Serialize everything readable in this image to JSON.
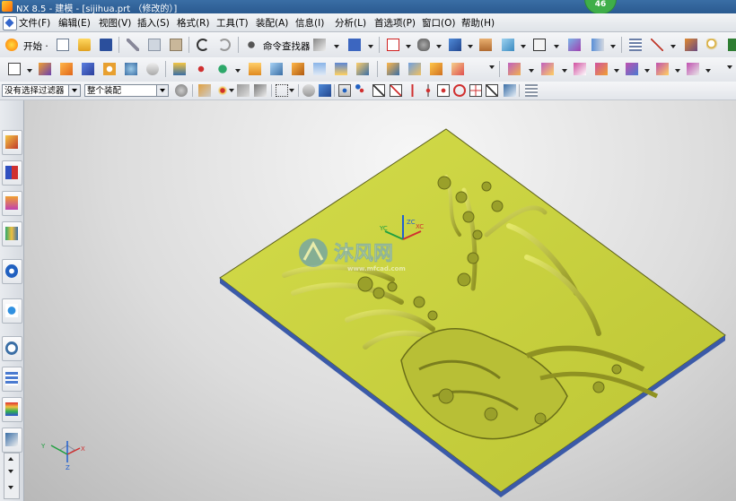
{
  "window": {
    "title": "NX 8.5 - 建模 - [sijihua.prt （修改的）]",
    "badge": "46"
  },
  "menu": [
    "文件(F)",
    "编辑(E)",
    "视图(V)",
    "插入(S)",
    "格式(R)",
    "工具(T)",
    "装配(A)",
    "信息(I)",
    "分析(L)",
    "首选项(P)",
    "窗口(O)",
    "帮助(H)"
  ],
  "toolbar": {
    "start_label": "开始 ·",
    "command_finder_label": "命令查找器"
  },
  "selection_bar": {
    "filter_value": "没有选择过滤器",
    "scope_value": "整个装配"
  },
  "viewport": {
    "watermark": "沐风网",
    "watermark_url": "www.mfcad.com",
    "triad_labels": {
      "x": "XC",
      "y": "YC",
      "z": "ZC"
    },
    "view_triad": {
      "x": "X",
      "y": "Y",
      "z": "Z"
    }
  },
  "colors": {
    "model_face": "#c8d23a",
    "model_edge": "#3b5aa8",
    "viewport_bg": "#d9d9d9"
  }
}
